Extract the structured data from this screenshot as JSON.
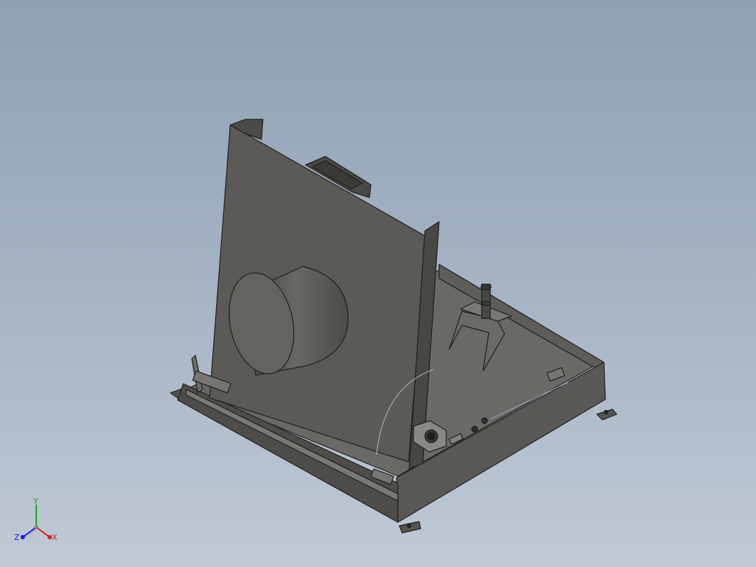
{
  "viewport": {
    "background_top": "#8fa0b4",
    "background_bottom": "#c0c9d5",
    "model_color": "#5a5854",
    "model_edge_color": "#1e1e1e"
  },
  "triad": {
    "x_label": "X",
    "y_label": "Y",
    "z_label": "Z",
    "x_color": "#d41a1a",
    "y_color": "#1aa01a",
    "z_color": "#1a1ad4"
  }
}
